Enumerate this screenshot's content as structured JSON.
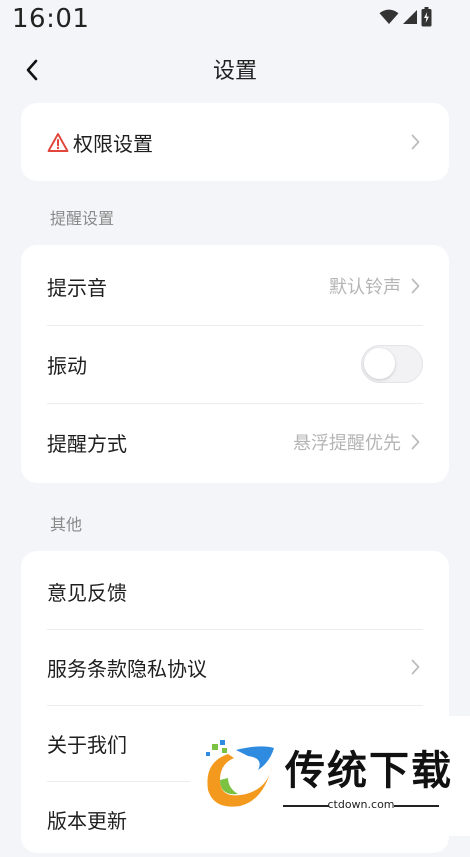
{
  "status_bar": {
    "time": "16:01",
    "icons": [
      "wifi-icon",
      "signal-icon",
      "battery-icon"
    ]
  },
  "nav": {
    "back_icon": "chevron-left-icon",
    "title": "设置"
  },
  "permission_card": {
    "icon": "warning-icon",
    "icon_color": "#e0463a",
    "label": "权限设置"
  },
  "reminder_section": {
    "title": "提醒设置",
    "sound": {
      "label": "提示音",
      "value": "默认铃声"
    },
    "vibration": {
      "label": "振动",
      "enabled": false
    },
    "mode": {
      "label": "提醒方式",
      "value": "悬浮提醒优先"
    }
  },
  "other_section": {
    "title": "其他",
    "items": [
      {
        "label": "意见反馈",
        "has_chevron": false
      },
      {
        "label": "服务条款隐私协议",
        "has_chevron": true
      },
      {
        "label": "关于我们",
        "has_chevron": false
      },
      {
        "label": "版本更新",
        "has_chevron": false
      }
    ]
  },
  "watermark": {
    "text": "传统下载",
    "site": "ctdown.com"
  },
  "colors": {
    "background": "#f4f5f9",
    "card": "#ffffff",
    "text": "#1f1f1f",
    "secondary_text": "#b5b5b5",
    "section_text": "#8a8a8a"
  }
}
